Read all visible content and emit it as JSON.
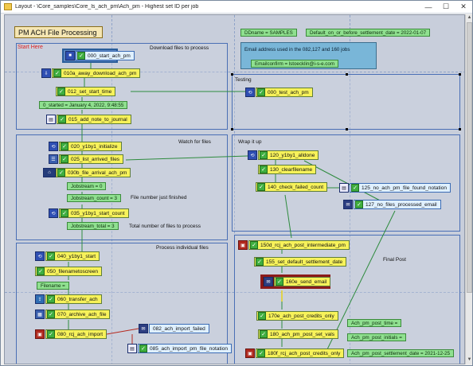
{
  "window": {
    "title": "Layout - \\Core_samples\\Core_ls_ach_pm\\Ach_pm - Highest set ID per job",
    "min": "—",
    "max": "☐",
    "close": "✕"
  },
  "colors": {
    "task_yellow": "#f7f25a",
    "check_green": "#3fae3f",
    "variable_green": "#8fe08f",
    "group_border": "#4a6fb5",
    "selected_border": "#8b1a1a"
  },
  "header": {
    "title": "PM ACH File Processing",
    "start_label": "Start Here"
  },
  "groups": {
    "download": "Download files to process",
    "watch": "Watch for files",
    "individual": "Process individual files",
    "testing": "Testing",
    "wrapup": "Wrap it up",
    "finalpost": "Final Post"
  },
  "info_box": {
    "line1": "Email address used in the 082,127 and 160 jobs",
    "emailconfirm": "Emailconfirm = lstoecklin@i-s-e.com"
  },
  "globals": {
    "ddname": "DDname = SAMPLES",
    "default_date": "Default_on_or_before_settlement_date = 2022-01-07"
  },
  "nodes": {
    "n000": "000_start_ach_pm",
    "n010": "010a_away_download_ach_pm",
    "n012": "012_set_start_time",
    "v0started": "0_started = January 4, 2022, 9:48:55",
    "n015": "015_add_note_to_journal",
    "n020": "020_y1by1_initialize",
    "n025": "025_list_arrived_files",
    "n030": "030b_file_arrival_ach_pm",
    "vjob0": "Jobstream = 0",
    "vjobcount": "Jobstream_count = 3",
    "note_first": "File number just finished",
    "n035": "035_y1by1_start_count",
    "vjobtotal": "Jobstream_total = 3",
    "note_total": "Total number of files to process",
    "n040": "040_y1by1_start",
    "n050": "050_filenametoscreen",
    "vfilename": "Filename =",
    "n060": "060_transfer_ach",
    "n070": "070_archive_ach_file",
    "n080": "080_rcj_ach_import",
    "n082": "082_ach_import_failed",
    "n085": "085_ach_import_pm_file_notation",
    "n000t": "000_test_ach_pm",
    "n120": "120_y1by1_alldone",
    "n130": "130_clearfilename",
    "n140": "140_check_failed_count",
    "n125": "125_no_ach_pm_file_found_notation",
    "n127": "127_no_files_processed_email",
    "n150": "150d_rcj_ach_post_intermediate_pm",
    "n155": "155_set_default_settlement_date",
    "n160": "160e_send_email",
    "n170": "170e_ach_post_credits_only",
    "n180": "180_ach_pm_post_set_vals",
    "n180f": "180f_rcj_ach_post_credits_only",
    "vposttime": "Ach_pm_post_time =",
    "vinitials": "Ach_pm_post_initials =",
    "vsettle": "Ach_pm_post_settlement_date = 2021-12-25"
  }
}
